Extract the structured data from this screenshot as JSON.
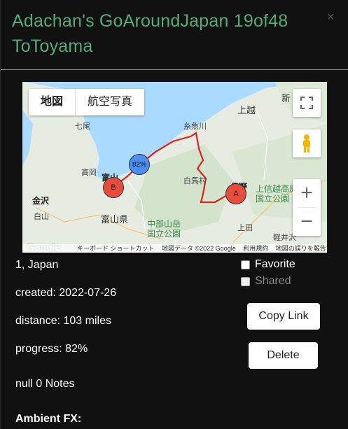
{
  "modal": {
    "title": "Adachan's GoAroundJapan 19of48 ToToyama",
    "close_glyph": "×"
  },
  "map": {
    "maptype_map": "地図",
    "maptype_satellite": "航空写真",
    "fullscreen_icon": "fullscreen-icon",
    "pegman_icon": "pegman-icon",
    "zoom_in": "+",
    "zoom_out": "−",
    "marker_a": "A",
    "marker_b": "B",
    "progress_marker": "82%",
    "labels": {
      "shinjo": "上越",
      "nanao": "七尾",
      "itoigawa": "糸魚川",
      "takaoka": "高岡",
      "toyama": "富山",
      "kanazawa": "金沢",
      "hakuba": "白馬村",
      "nagano": "長野",
      "toyama_pref": "富山県",
      "hakusan": "白山",
      "chubu_park": "中部山岳\n国立公園",
      "joshinetsu": "上信越高原\n国立公園",
      "ueda": "上田",
      "karuizawa": "軽井沢",
      "niigata_short": "新"
    },
    "attribution": {
      "shortcuts": "キーボード ショートカット",
      "data": "地図データ ©2022 Google",
      "terms": "利用規約",
      "report": "地図の誤りを報告する"
    },
    "logo": "Google"
  },
  "details": {
    "location": "1, Japan",
    "created": "created: 2022-07-26",
    "distance": "distance: 103 miles",
    "progress": "progress: 82%",
    "notes": "null  0 Notes",
    "ambient": "Ambient FX:"
  },
  "actions": {
    "favorite": "Favorite",
    "shared": "Shared",
    "copy_link": "Copy Link",
    "delete": "Delete"
  },
  "colors": {
    "title_green": "#4fae77",
    "route_red": "#e0201c",
    "marker_red": "#e74c3c",
    "marker_blue": "#3b82f6"
  }
}
